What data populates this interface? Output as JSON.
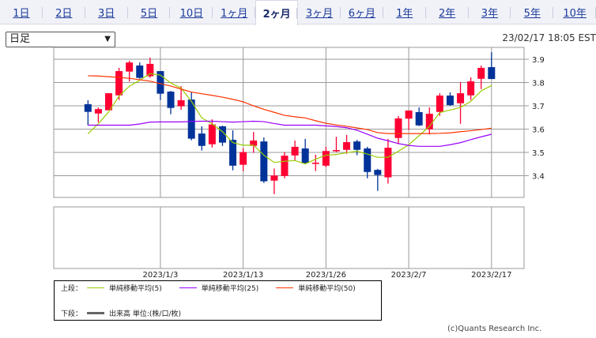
{
  "tabs": [
    {
      "label": "1日"
    },
    {
      "label": "2日"
    },
    {
      "label": "3日"
    },
    {
      "label": "5日"
    },
    {
      "label": "10日"
    },
    {
      "label": "1ヶ月"
    },
    {
      "label": "2ヶ月",
      "active": true
    },
    {
      "label": "3ヶ月"
    },
    {
      "label": "6ヶ月"
    },
    {
      "label": "1年"
    },
    {
      "label": "2年"
    },
    {
      "label": "3年"
    },
    {
      "label": "5年"
    },
    {
      "label": "10年"
    }
  ],
  "period_select": {
    "value": "日足"
  },
  "timestamp": "23/02/17 18:05 EST",
  "legend": {
    "upper_label": "上段：",
    "lower_label": "下段：",
    "ma5": "単純移動平均(5)",
    "ma25": "単純移動平均(25)",
    "ma50": "単純移動平均(50)",
    "volume": "出来高 単位:(株/口/枚)",
    "colors": {
      "ma5": "#99cc00",
      "ma25": "#9900ff",
      "ma50": "#ff3300",
      "volume": "#666666",
      "up": "#ff0033",
      "down": "#003399"
    }
  },
  "copyright": "(c)Quants Research Inc.",
  "chart_data": {
    "type": "candlestick",
    "ylim": [
      3.35,
      3.95
    ],
    "yticks": [
      "3.4",
      "3.5",
      "3.6",
      "3.7",
      "3.8",
      "3.9"
    ],
    "xtick_labels": [
      {
        "index": 7,
        "label": "2023/1/3"
      },
      {
        "index": 15,
        "label": "2023/1/13"
      },
      {
        "index": 23,
        "label": "2023/1/26"
      },
      {
        "index": 31,
        "label": "2023/2/7"
      },
      {
        "index": 39,
        "label": "2023/2/17"
      }
    ],
    "open": [
      3.707,
      3.667,
      3.681,
      3.745,
      3.847,
      3.873,
      3.827,
      3.849,
      3.761,
      3.698,
      3.727,
      3.581,
      3.535,
      3.612,
      3.554,
      3.447,
      3.528,
      3.547,
      3.379,
      3.399,
      3.487,
      3.517,
      3.454,
      3.443,
      3.509,
      3.511,
      3.547,
      3.517,
      3.425,
      3.393,
      3.562,
      3.645,
      3.673,
      3.599,
      3.674,
      3.744,
      3.711,
      3.745,
      3.816,
      3.866
    ],
    "high": [
      3.724,
      3.693,
      3.754,
      3.863,
      3.893,
      3.886,
      3.907,
      3.849,
      3.764,
      3.785,
      3.758,
      3.612,
      3.642,
      3.615,
      3.595,
      3.518,
      3.588,
      3.564,
      3.431,
      3.502,
      3.551,
      3.558,
      3.49,
      3.524,
      3.567,
      3.575,
      3.554,
      3.524,
      3.429,
      3.558,
      3.656,
      3.68,
      3.693,
      3.693,
      3.754,
      3.758,
      3.802,
      3.822,
      3.873,
      3.93
    ],
    "low": [
      3.616,
      3.629,
      3.681,
      3.725,
      3.804,
      3.816,
      3.82,
      3.725,
      3.664,
      3.683,
      3.552,
      3.508,
      3.521,
      3.528,
      3.423,
      3.42,
      3.498,
      3.369,
      3.321,
      3.389,
      3.465,
      3.451,
      3.42,
      3.437,
      3.501,
      3.494,
      3.488,
      3.389,
      3.335,
      3.366,
      3.535,
      3.596,
      3.613,
      3.577,
      3.657,
      3.7,
      3.623,
      3.725,
      3.772,
      3.815
    ],
    "close": [
      3.674,
      3.686,
      3.754,
      3.849,
      3.886,
      3.82,
      3.88,
      3.752,
      3.691,
      3.724,
      3.559,
      3.528,
      3.62,
      3.542,
      3.443,
      3.501,
      3.551,
      3.376,
      3.401,
      3.486,
      3.524,
      3.454,
      3.456,
      3.506,
      3.51,
      3.544,
      3.511,
      3.416,
      3.403,
      3.52,
      3.646,
      3.68,
      3.616,
      3.666,
      3.744,
      3.703,
      3.754,
      3.805,
      3.863,
      3.815
    ],
    "series": [
      {
        "name": "ma5",
        "values": [
          3.58,
          3.623,
          3.674,
          3.742,
          3.784,
          3.81,
          3.838,
          3.832,
          3.798,
          3.776,
          3.719,
          3.648,
          3.623,
          3.589,
          3.542,
          3.531,
          3.531,
          3.488,
          3.457,
          3.462,
          3.465,
          3.451,
          3.471,
          3.488,
          3.491,
          3.499,
          3.505,
          3.493,
          3.479,
          3.479,
          3.505,
          3.533,
          3.572,
          3.612,
          3.671,
          3.682,
          3.693,
          3.719,
          3.764,
          3.787
        ]
      },
      {
        "name": "ma_red",
        "values": [
          3.829,
          3.828,
          3.825,
          3.822,
          3.818,
          3.812,
          3.806,
          3.795,
          3.785,
          3.772,
          3.759,
          3.752,
          3.745,
          3.737,
          3.728,
          3.717,
          3.7,
          3.685,
          3.672,
          3.659,
          3.653,
          3.648,
          3.636,
          3.625,
          3.618,
          3.612,
          3.605,
          3.598,
          3.585,
          3.581,
          3.581,
          3.581,
          3.581,
          3.581,
          3.582,
          3.584,
          3.589,
          3.593,
          3.598,
          3.604
        ]
      },
      {
        "name": "ma_purple",
        "values": [
          3.617,
          3.617,
          3.617,
          3.617,
          3.617,
          3.622,
          3.63,
          3.631,
          3.631,
          3.631,
          3.633,
          3.634,
          3.634,
          3.632,
          3.63,
          3.632,
          3.634,
          3.632,
          3.624,
          3.617,
          3.617,
          3.617,
          3.617,
          3.614,
          3.611,
          3.606,
          3.595,
          3.578,
          3.561,
          3.55,
          3.538,
          3.53,
          3.526,
          3.526,
          3.526,
          3.533,
          3.542,
          3.555,
          3.567,
          3.578
        ]
      }
    ]
  }
}
